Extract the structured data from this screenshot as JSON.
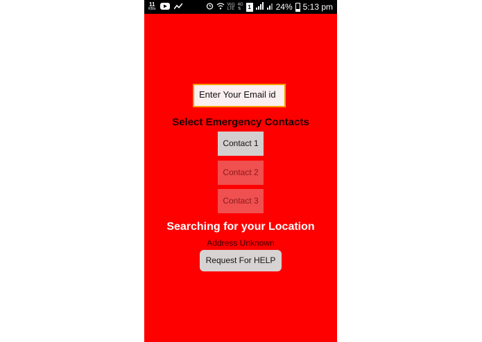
{
  "status_bar": {
    "net_speed_value": "11",
    "net_speed_unit": "KB/s",
    "sim_label": "1",
    "volte_top": "Vo))",
    "volte_bottom": "LTE",
    "network_type": "4G",
    "battery_percent": "24%",
    "time": "5:13 pm",
    "battery_level": 0.24
  },
  "email_input": {
    "placeholder": "Enter Your Email id"
  },
  "contacts_section": {
    "title": "Select Emergency Contacts",
    "buttons": [
      {
        "label": "Contact 1"
      },
      {
        "label": "Contact 2"
      },
      {
        "label": "Contact  3"
      }
    ]
  },
  "location_section": {
    "title": "Searching for your Location",
    "address": "Address Unknown"
  },
  "help_button": {
    "label": "Request For HELP"
  },
  "colors": {
    "background": "#ff0000",
    "email_border": "#f5a000",
    "button_enabled": "#d4cfcf",
    "button_disabled": "#f05050"
  }
}
